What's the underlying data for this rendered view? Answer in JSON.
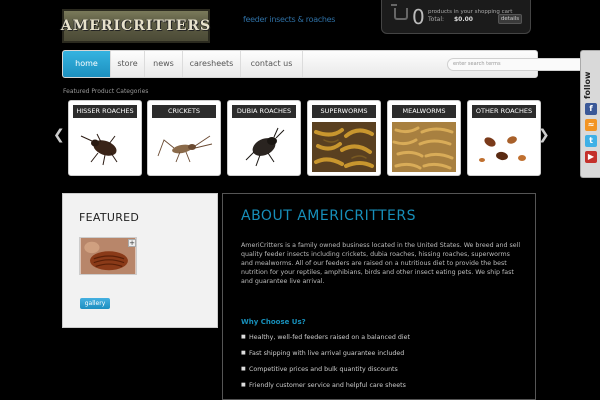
{
  "header": {
    "logo_text": "AMERICRITTERS",
    "tagline": "feeder insects & roaches"
  },
  "cart": {
    "count": "0",
    "label": "products in your shopping cart",
    "total_label": "Total:",
    "total_value": "$0.00",
    "details_label": "details"
  },
  "nav": {
    "items": [
      {
        "label": "home"
      },
      {
        "label": "store"
      },
      {
        "label": "news"
      },
      {
        "label": "caresheets"
      },
      {
        "label": "contact us"
      }
    ],
    "search_placeholder": "enter search terms"
  },
  "categories": {
    "heading": "Featured Product Categories",
    "items": [
      {
        "label": "HISSER ROACHES"
      },
      {
        "label": "CRICKETS"
      },
      {
        "label": "DUBIA ROACHES"
      },
      {
        "label": "SUPERWORMS"
      },
      {
        "label": "MEALWORMS"
      },
      {
        "label": "OTHER ROACHES"
      }
    ]
  },
  "featured": {
    "title": "FEATURED",
    "button_label": "gallery"
  },
  "about": {
    "title": "ABOUT AMERICRITTERS",
    "body": "AmeriCritters is a family owned business located in the United States. We breed and sell quality feeder insects including crickets, dubia roaches, hissing roaches, superworms and mealworms. All of our feeders are raised on a nutritious diet to provide the best nutrition for your reptiles, amphibians, birds and other insect eating pets. We ship fast and guarantee live arrival.",
    "subtitle": "Why Choose Us?",
    "points": [
      "Healthy, well-fed feeders raised on a balanced diet",
      "Fast shipping with live arrival guarantee included",
      "Competitive prices and bulk quantity discounts",
      "Friendly customer service and helpful care sheets"
    ]
  },
  "follow": {
    "label": "follow"
  }
}
